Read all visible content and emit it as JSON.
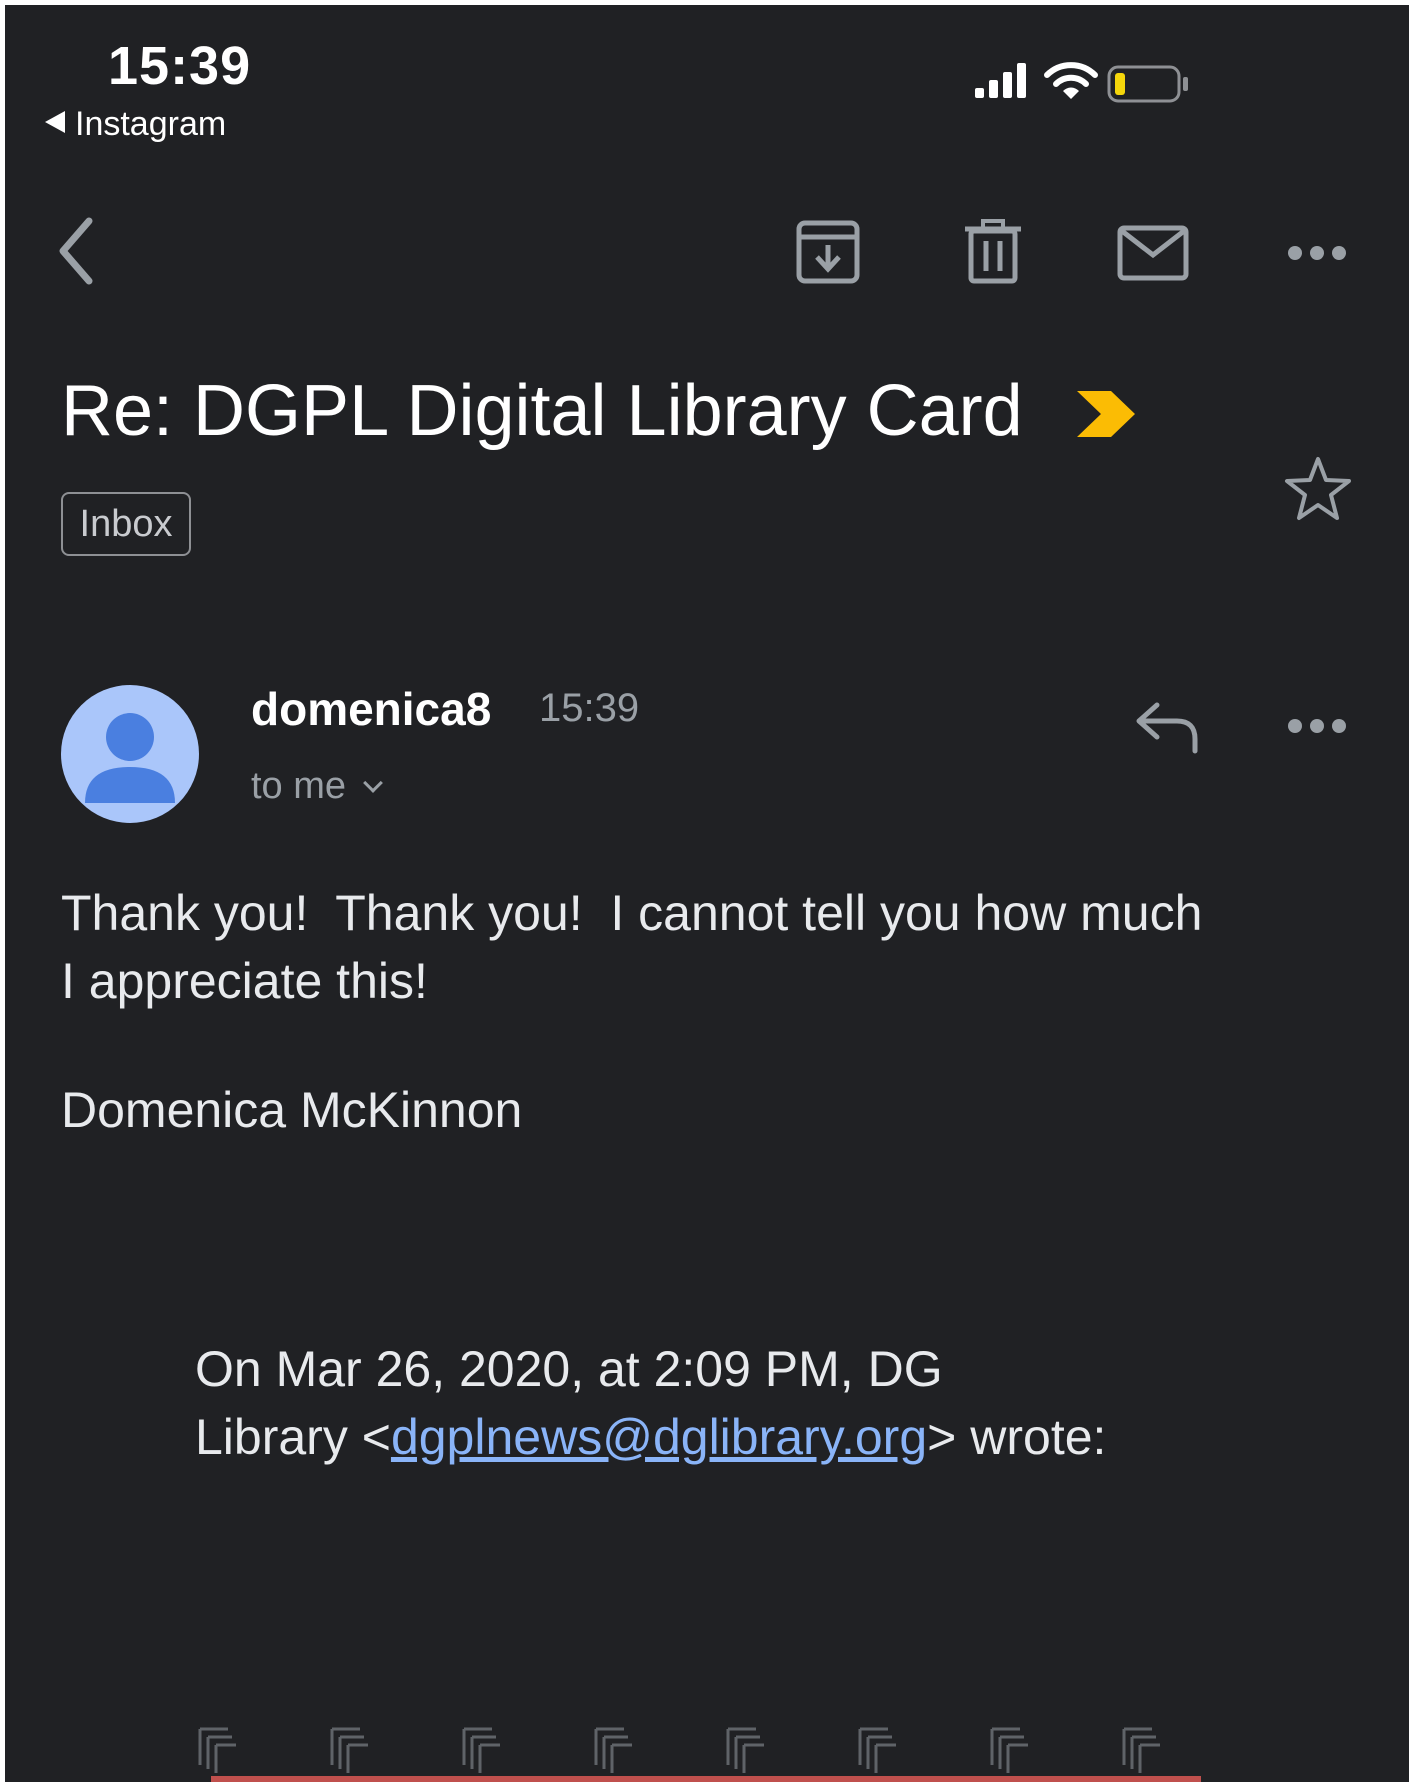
{
  "status_bar": {
    "time": "15:39",
    "back_app": "Instagram",
    "signal_icon": "cellular-signal-icon",
    "wifi_icon": "wifi-icon",
    "battery_icon": "battery-low-icon",
    "battery_color": "#f5d60b"
  },
  "toolbar": {
    "back_icon": "back-arrow-icon",
    "archive_icon": "archive-icon",
    "delete_icon": "trash-icon",
    "mark_unread_icon": "mail-icon",
    "more_icon": "more-horizontal-icon"
  },
  "email": {
    "subject": "Re: DGPL Digital Library Card",
    "importance_icon": "importance-marker-icon",
    "importance_color": "#fbbc04",
    "label": "Inbox",
    "star_icon": "star-outline-icon",
    "sender": "domenica8",
    "time": "15:39",
    "recipient": "to me",
    "reply_icon": "reply-icon",
    "body_lines": [
      "Thank you!  Thank you!  I cannot tell you how much",
      "I appreciate this!"
    ],
    "signature": "Domenica McKinnon",
    "quote": {
      "line1": "On Mar 26, 2020, at 2:09 PM, DG",
      "line2_prefix": "Library <",
      "link": "dgplnews@dglibrary.org",
      "line2_suffix": "> wrote:"
    }
  },
  "colors": {
    "background": "#202124",
    "text": "#e8eaed",
    "secondary_text": "#9aa0a6",
    "link": "#8ab4f8",
    "avatar_bg": "#aac6fa",
    "avatar_fg": "#4a7fe0"
  }
}
